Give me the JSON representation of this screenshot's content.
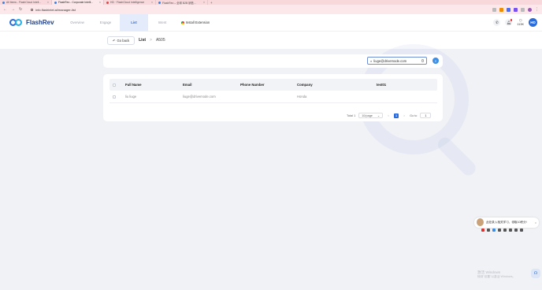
{
  "browser": {
    "tabs": [
      {
        "label": "All Items - FlashCloud Intell...",
        "active": false
      },
      {
        "label": "FlashRev - Corporate Intelli...",
        "active": true
      },
      {
        "label": "HD · FlashCloud Intelligence",
        "active": false
      },
      {
        "label": "FlashRev – 全球 B2B 销售...",
        "active": false
      }
    ],
    "new_tab": "+",
    "url": "info.flashintel.ai/manager-list"
  },
  "app": {
    "logo_text": "FlashRev",
    "nav": [
      {
        "label": "Overview",
        "active": false
      },
      {
        "label": "Engage",
        "active": false
      },
      {
        "label": "List",
        "active": true
      },
      {
        "label": "Intent",
        "active": false
      }
    ],
    "install_extension": "Install Extension",
    "credits": "113K",
    "avatar": "HD"
  },
  "subheader": {
    "go_back": "Go back",
    "crumb_current": "List",
    "crumb_separator": ">",
    "crumb_leaf": "A505"
  },
  "search": {
    "value": "liuge@drivemode.com",
    "button_icon": "search-icon"
  },
  "table": {
    "columns": [
      "Full Name",
      "Email",
      "Phone Number",
      "Company",
      "test01"
    ],
    "rows": [
      {
        "name": "liu liuge",
        "email": "liuge@drivemode.com",
        "phone": "",
        "company": "Honda",
        "test01": ""
      }
    ]
  },
  "pager": {
    "total": "Total 1",
    "page_size": "10/page",
    "prev": "<",
    "current": "1",
    "next": ">",
    "goto_label": "Go to",
    "goto_value": "1"
  },
  "ime": {
    "text": "此处录入相关学习，领取10积分!",
    "close": "×"
  },
  "windows": {
    "activate_title": "激活 Windows",
    "activate_sub": "转到\"设置\"以激活 Windows。"
  },
  "colors": {
    "brand": "#2a6bdc",
    "tab_strip": "#f8d8da"
  }
}
